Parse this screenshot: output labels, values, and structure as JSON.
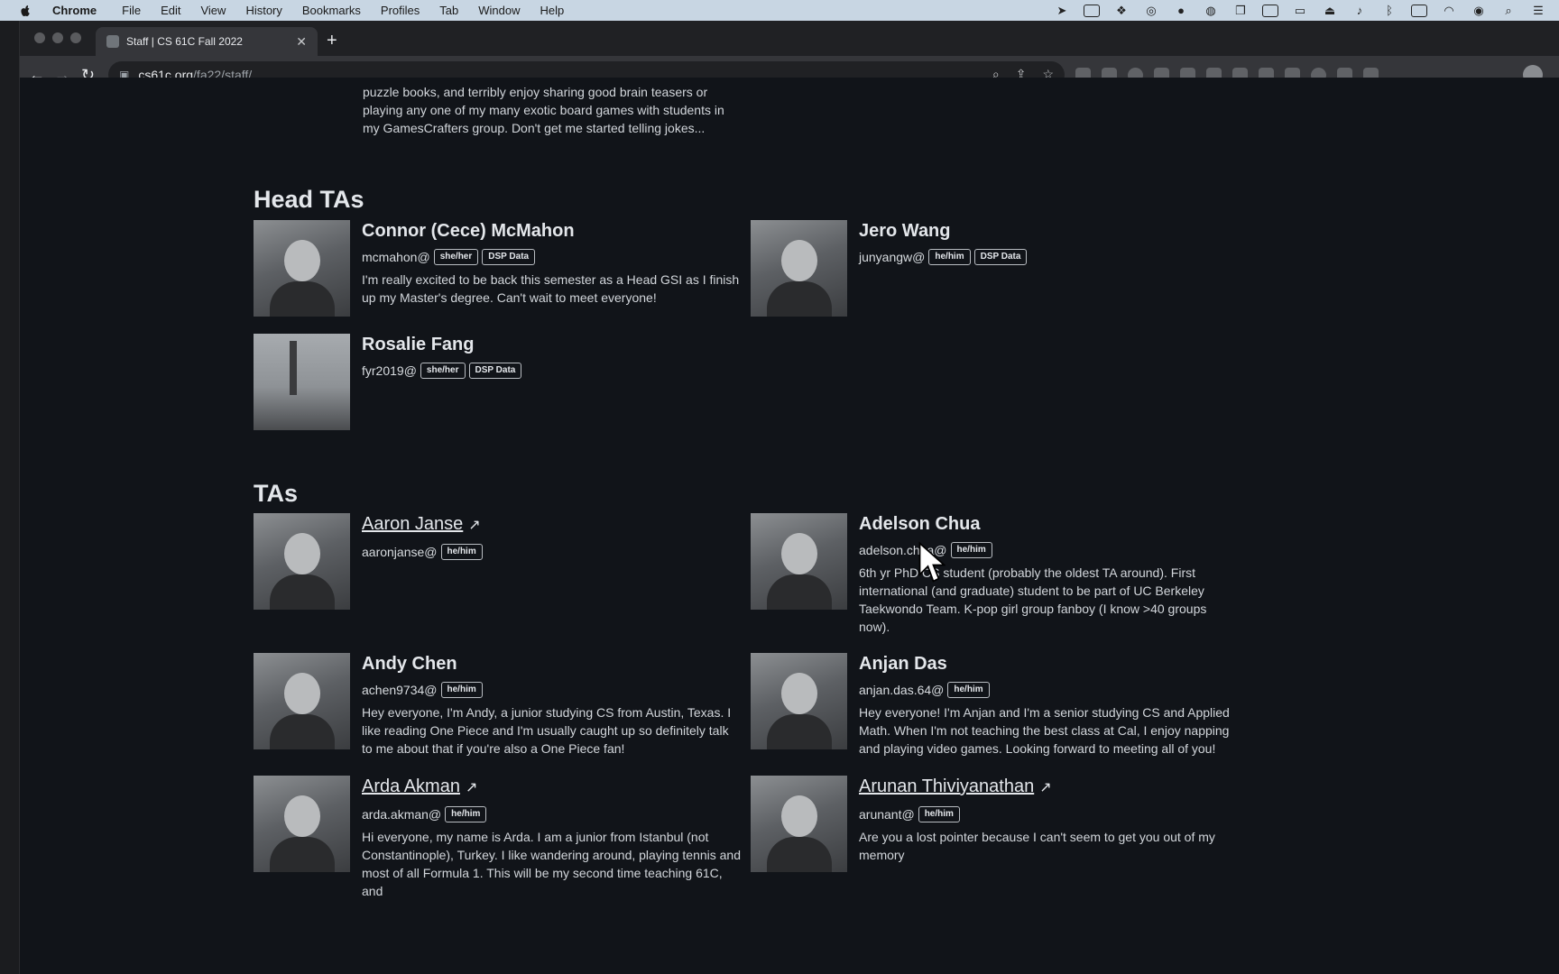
{
  "menubar": {
    "app": "Chrome",
    "items": [
      "File",
      "Edit",
      "View",
      "History",
      "Bookmarks",
      "Profiles",
      "Tab",
      "Window",
      "Help"
    ]
  },
  "browser": {
    "tab_title": "Staff | CS 61C Fall 2022",
    "url_host": "cs61c.org",
    "url_path": "/fa22/staff/"
  },
  "intro_text": "puzzle books, and terribly enjoy sharing good brain teasers or playing any one of my many exotic board games with students in my GamesCrafters group. Don't get me started telling jokes...",
  "head_tas": {
    "title": "Head TAs",
    "people": [
      {
        "name": "Connor (Cece) McMahon",
        "email": "mcmahon@",
        "badges": [
          "she/her",
          "DSP Data"
        ],
        "bio": "I'm really excited to be back this semester as a Head GSI as I finish up my Master's degree. Can't wait to meet everyone!"
      },
      {
        "name": "Jero Wang",
        "email": "junyangw@",
        "badges": [
          "he/him",
          "DSP Data"
        ],
        "bio": ""
      },
      {
        "name": "Rosalie Fang",
        "email": "fyr2019@",
        "badges": [
          "she/her",
          "DSP Data"
        ],
        "bio": ""
      }
    ]
  },
  "tas": {
    "title": "TAs",
    "people": [
      {
        "name": "Aaron Janse",
        "email": "aaronjanse@",
        "badges": [
          "he/him"
        ],
        "bio": "",
        "link": true
      },
      {
        "name": "Adelson Chua",
        "email": "adelson.chua@",
        "badges": [
          "he/him"
        ],
        "bio": "6th yr PhD CS student (probably the oldest TA around). First international (and graduate) student to be part of UC Berkeley Taekwondo Team. K-pop girl group fanboy (I know >40 groups now).",
        "link": false
      },
      {
        "name": "Andy Chen",
        "email": "achen9734@",
        "badges": [
          "he/him"
        ],
        "bio": "Hey everyone, I'm Andy, a junior studying CS from Austin, Texas. I like reading One Piece and I'm usually caught up so definitely talk to me about that if you're also a One Piece fan!",
        "link": false
      },
      {
        "name": "Anjan Das",
        "email": "anjan.das.64@",
        "badges": [
          "he/him"
        ],
        "bio": "Hey everyone! I'm Anjan and I'm a senior studying CS and Applied Math. When I'm not teaching the best class at Cal, I enjoy napping and playing video games. Looking forward to meeting all of you!",
        "link": false
      },
      {
        "name": "Arda Akman",
        "email": "arda.akman@",
        "badges": [
          "he/him"
        ],
        "bio": "Hi everyone, my name is Arda. I am a junior from Istanbul (not Constantinople), Turkey. I like wandering around, playing tennis and most of all Formula 1. This will be my second time teaching 61C, and",
        "link": true
      },
      {
        "name": "Arunan Thiviyanathan",
        "email": "arunant@",
        "badges": [
          "he/him"
        ],
        "bio": "Are you a lost pointer because I can't seem to get you out of my memory",
        "link": true
      }
    ]
  },
  "icons": {
    "external_link": "↗",
    "close": "✕",
    "new_tab": "+",
    "back": "←",
    "forward": "→",
    "reload": "↻",
    "lock": "🔒"
  }
}
